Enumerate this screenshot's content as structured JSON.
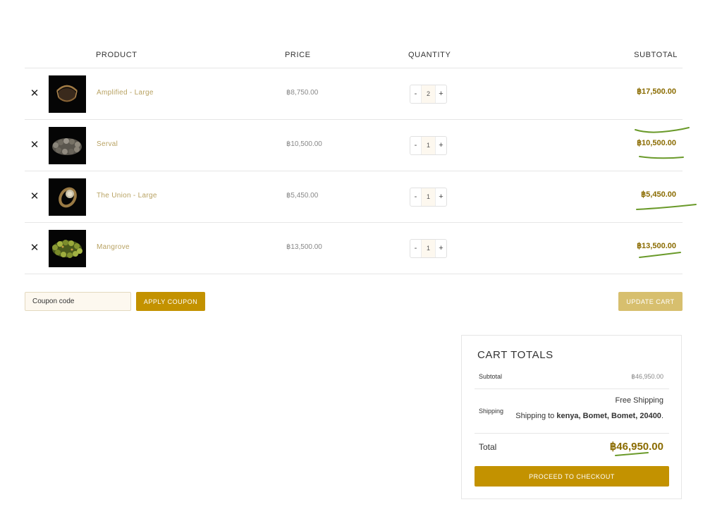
{
  "table": {
    "headers": {
      "product": "PRODUCT",
      "price": "PRICE",
      "quantity": "QUANTITY",
      "subtotal": "SUBTOTAL"
    },
    "remove_glyph": "✕",
    "qty_minus": "-",
    "qty_plus": "+",
    "rows": [
      {
        "name": "Amplified - Large",
        "price": "฿8,750.00",
        "quantity": "2",
        "subtotal": "฿17,500.00",
        "thumb_icon": "cuff-bracelet-image"
      },
      {
        "name": "Serval",
        "price": "฿10,500.00",
        "quantity": "1",
        "subtotal": "฿10,500.00",
        "thumb_icon": "beaded-bracelet-image"
      },
      {
        "name": "The Union - Large",
        "price": "฿5,450.00",
        "quantity": "1",
        "subtotal": "฿5,450.00",
        "thumb_icon": "ring-image"
      },
      {
        "name": "Mangrove",
        "price": "฿13,500.00",
        "quantity": "1",
        "subtotal": "฿13,500.00",
        "thumb_icon": "green-bead-bracelet-image"
      }
    ]
  },
  "actions": {
    "coupon_placeholder": "Coupon code",
    "apply_coupon": "APPLY COUPON",
    "update_cart": "UPDATE CART"
  },
  "totals": {
    "title": "CART TOTALS",
    "subtotal_label": "Subtotal",
    "subtotal_value": "฿46,950.00",
    "shipping_label": "Shipping",
    "shipping_method": "Free Shipping",
    "shipping_to_prefix": "Shipping to ",
    "shipping_destination": "kenya, Bomet, Bomet, 20400",
    "shipping_to_suffix": ".",
    "total_label": "Total",
    "total_value": "฿46,950.00",
    "checkout": "PROCEED TO CHECKOUT"
  },
  "colors": {
    "gold_button": "#c39200",
    "muted_gold_button": "#d7bf6e",
    "product_link": "#b8a262",
    "price_emphasis": "#8a6b00",
    "annotation_marker": "#6a9a2a"
  }
}
